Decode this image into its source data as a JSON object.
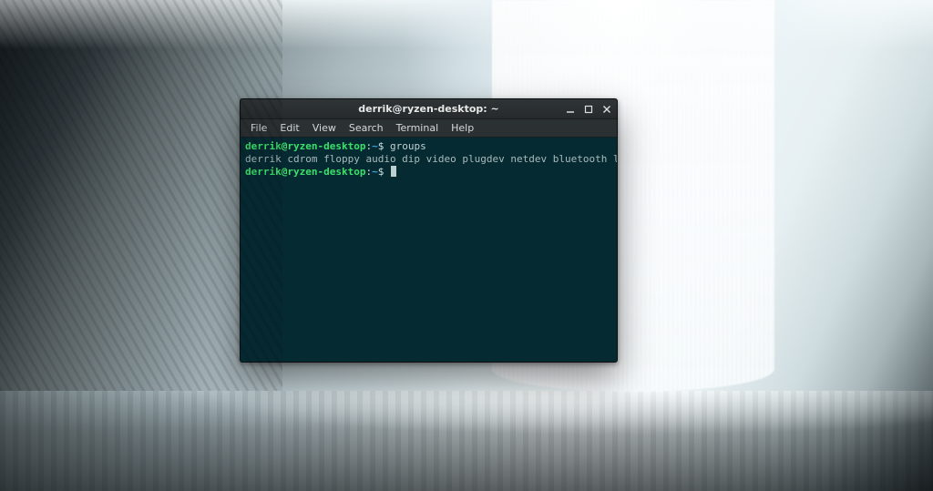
{
  "window": {
    "title": "derrik@ryzen-desktop: ~",
    "controls": {
      "minimize": "minimize",
      "maximize": "maximize",
      "close": "close"
    }
  },
  "menubar": {
    "items": [
      "File",
      "Edit",
      "View",
      "Search",
      "Terminal",
      "Help"
    ]
  },
  "terminal": {
    "prompt": {
      "user_host": "derrik@ryzen-desktop",
      "sep": ":",
      "path": "~",
      "symbol": "$"
    },
    "lines": [
      {
        "type": "cmd",
        "text": "groups"
      },
      {
        "type": "out",
        "text": "derrik cdrom floppy audio dip video plugdev netdev bluetooth lpadmin scanner"
      },
      {
        "type": "prompt_only"
      }
    ]
  },
  "colors": {
    "term_bg": "#062a32",
    "prompt_user": "#3be06a",
    "prompt_path": "#3aa7e0",
    "text": "#a8bbbb"
  }
}
